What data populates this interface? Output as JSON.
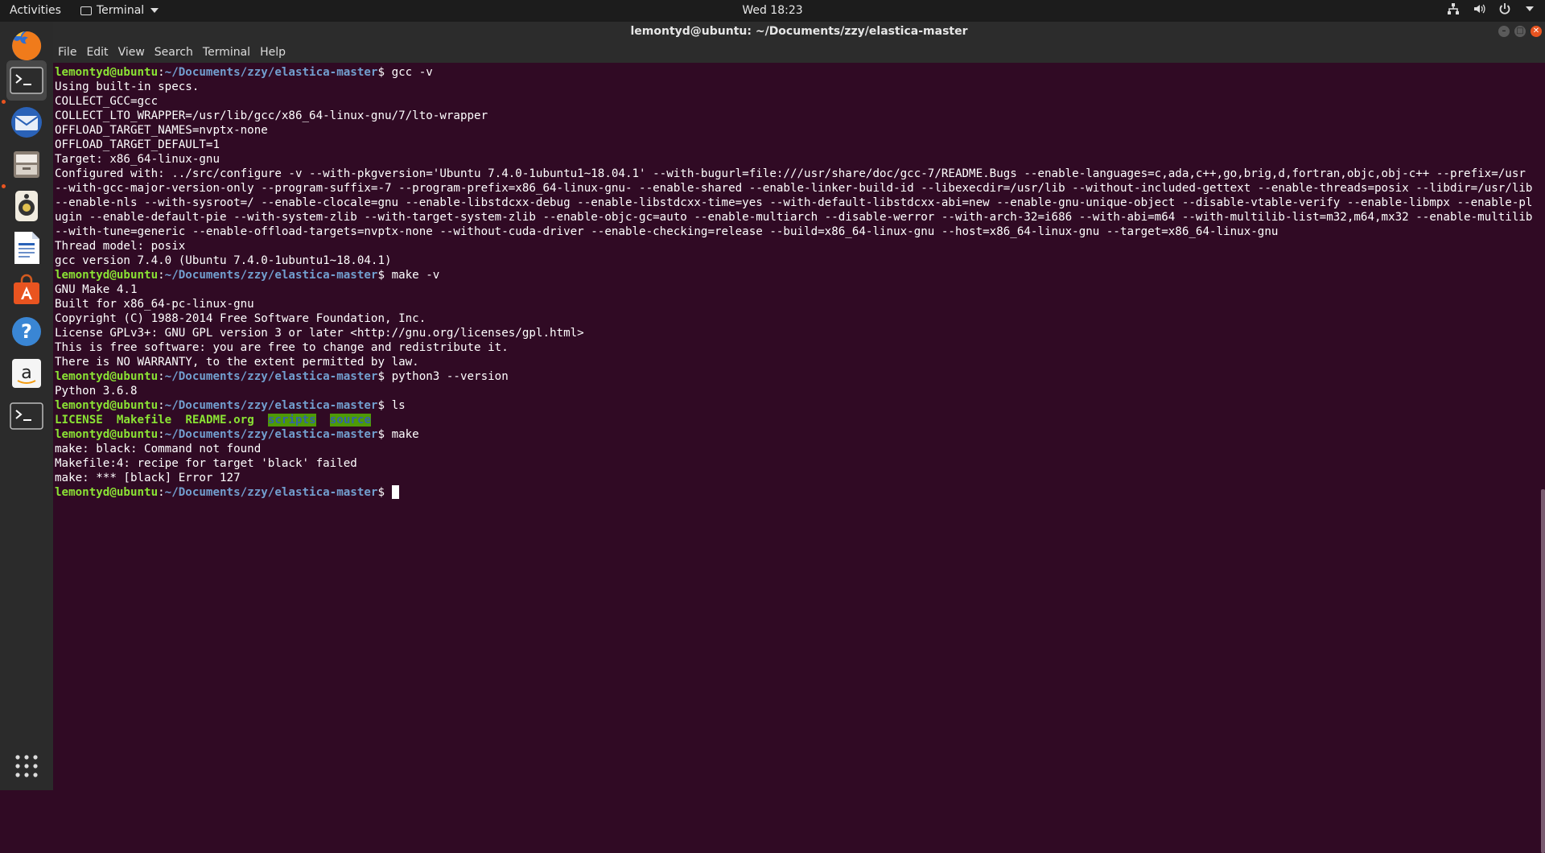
{
  "topbar": {
    "activities": "Activities",
    "app_menu": "Terminal",
    "clock": "Wed 18:23"
  },
  "dock": {
    "items": [
      "firefox",
      "terminal",
      "thunderbird",
      "files",
      "rhythmbox",
      "libreoffice-writer",
      "ubuntu-software",
      "help",
      "amazon",
      "terminal",
      "show-applications"
    ]
  },
  "window": {
    "title": "lemontyd@ubuntu: ~/Documents/zzy/elastica-master",
    "menu": [
      "File",
      "Edit",
      "View",
      "Search",
      "Terminal",
      "Help"
    ]
  },
  "terminal": {
    "prompt_user": "lemontyd@ubuntu",
    "prompt_path": "~/Documents/zzy/elastica-master",
    "blocks": [
      {
        "cmd": "gcc -v",
        "out": [
          "Using built-in specs.",
          "COLLECT_GCC=gcc",
          "COLLECT_LTO_WRAPPER=/usr/lib/gcc/x86_64-linux-gnu/7/lto-wrapper",
          "OFFLOAD_TARGET_NAMES=nvptx-none",
          "OFFLOAD_TARGET_DEFAULT=1",
          "Target: x86_64-linux-gnu",
          "Configured with: ../src/configure -v --with-pkgversion='Ubuntu 7.4.0-1ubuntu1~18.04.1' --with-bugurl=file:///usr/share/doc/gcc-7/README.Bugs --enable-languages=c,ada,c++,go,brig,d,fortran,objc,obj-c++ --prefix=/usr --with-gcc-major-version-only --program-suffix=-7 --program-prefix=x86_64-linux-gnu- --enable-shared --enable-linker-build-id --libexecdir=/usr/lib --without-included-gettext --enable-threads=posix --libdir=/usr/lib --enable-nls --with-sysroot=/ --enable-clocale=gnu --enable-libstdcxx-debug --enable-libstdcxx-time=yes --with-default-libstdcxx-abi=new --enable-gnu-unique-object --disable-vtable-verify --enable-libmpx --enable-plugin --enable-default-pie --with-system-zlib --with-target-system-zlib --enable-objc-gc=auto --enable-multiarch --disable-werror --with-arch-32=i686 --with-abi=m64 --with-multilib-list=m32,m64,mx32 --enable-multilib --with-tune=generic --enable-offload-targets=nvptx-none --without-cuda-driver --enable-checking=release --build=x86_64-linux-gnu --host=x86_64-linux-gnu --target=x86_64-linux-gnu",
          "Thread model: posix",
          "gcc version 7.4.0 (Ubuntu 7.4.0-1ubuntu1~18.04.1)"
        ]
      },
      {
        "cmd": "make -v",
        "out": [
          "GNU Make 4.1",
          "Built for x86_64-pc-linux-gnu",
          "Copyright (C) 1988-2014 Free Software Foundation, Inc.",
          "License GPLv3+: GNU GPL version 3 or later <http://gnu.org/licenses/gpl.html>",
          "This is free software: you are free to change and redistribute it.",
          "There is NO WARRANTY, to the extent permitted by law."
        ]
      },
      {
        "cmd": "python3 --version",
        "out": [
          "Python 3.6.8"
        ]
      },
      {
        "cmd": "ls",
        "ls": [
          {
            "name": "LICENSE",
            "kind": "file"
          },
          {
            "name": "Makefile",
            "kind": "file"
          },
          {
            "name": "README.org",
            "kind": "file"
          },
          {
            "name": "scripts",
            "kind": "dir"
          },
          {
            "name": "source",
            "kind": "dir"
          }
        ]
      },
      {
        "cmd": "make",
        "out": [
          "make: black: Command not found",
          "Makefile:4: recipe for target 'black' failed",
          "make: *** [black] Error 127"
        ]
      },
      {
        "cmd": "",
        "cursor": true
      }
    ]
  },
  "colors": {
    "terminal_bg": "#300a24",
    "prompt_user": "#8ae234",
    "prompt_path": "#729fcf",
    "accent": "#e95420"
  }
}
